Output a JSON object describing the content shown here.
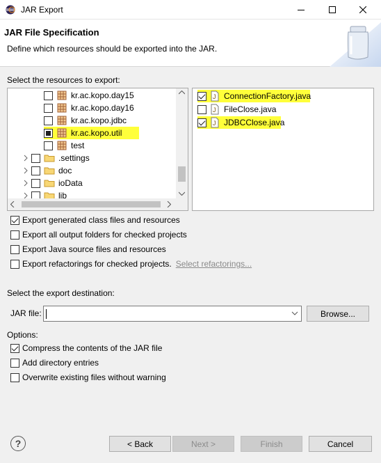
{
  "window": {
    "title": "JAR Export"
  },
  "header": {
    "title": "JAR File Specification",
    "description": "Define which resources should be exported into the JAR."
  },
  "resources_label": "Select the resources to export:",
  "tree": [
    {
      "label": "kr.ac.kopo.day15",
      "checked": "none",
      "highlight": false,
      "type": "package"
    },
    {
      "label": "kr.ac.kopo.day16",
      "checked": "none",
      "highlight": false,
      "type": "package"
    },
    {
      "label": "kr.ac.kopo.jdbc",
      "checked": "none",
      "highlight": false,
      "type": "package"
    },
    {
      "label": "kr.ac.kopo.util",
      "checked": "partial",
      "highlight": true,
      "type": "package"
    },
    {
      "label": "test",
      "checked": "none",
      "highlight": false,
      "type": "package"
    },
    {
      "label": ".settings",
      "checked": "none",
      "highlight": false,
      "type": "folder"
    },
    {
      "label": "doc",
      "checked": "none",
      "highlight": false,
      "type": "folder"
    },
    {
      "label": "ioData",
      "checked": "none",
      "highlight": false,
      "type": "folder"
    },
    {
      "label": "lib",
      "checked": "none",
      "highlight": false,
      "type": "folder"
    }
  ],
  "files": [
    {
      "label": "ConnectionFactory.java",
      "checked": true,
      "highlight": true
    },
    {
      "label": "FileClose.java",
      "checked": false,
      "highlight": false
    },
    {
      "label": "JDBCClose.java",
      "checked": true,
      "highlight": true
    }
  ],
  "options": {
    "export_class_files": {
      "label": "Export generated class files and resources",
      "checked": true
    },
    "export_output_folders": {
      "label": "Export all output folders for checked projects",
      "checked": false
    },
    "export_java_source": {
      "label": "Export Java source files and resources",
      "checked": false
    },
    "export_refactorings": {
      "label": "Export refactorings for checked projects.",
      "checked": false
    },
    "select_refactorings_link": "Select refactorings..."
  },
  "destination": {
    "label": "Select the export destination:",
    "jar_file_label": "JAR file:",
    "jar_file_value": "",
    "browse_label": "Browse..."
  },
  "jar_options": {
    "label": "Options:",
    "compress": {
      "label": "Compress the contents of the JAR file",
      "checked": true
    },
    "directory_entries": {
      "label": "Add directory entries",
      "checked": false
    },
    "overwrite": {
      "label": "Overwrite existing files without warning",
      "checked": false
    }
  },
  "footer": {
    "back": "< Back",
    "next": "Next >",
    "finish": "Finish",
    "cancel": "Cancel"
  },
  "colors": {
    "highlight": "#ffff3a",
    "background": "#f0f0f0"
  }
}
